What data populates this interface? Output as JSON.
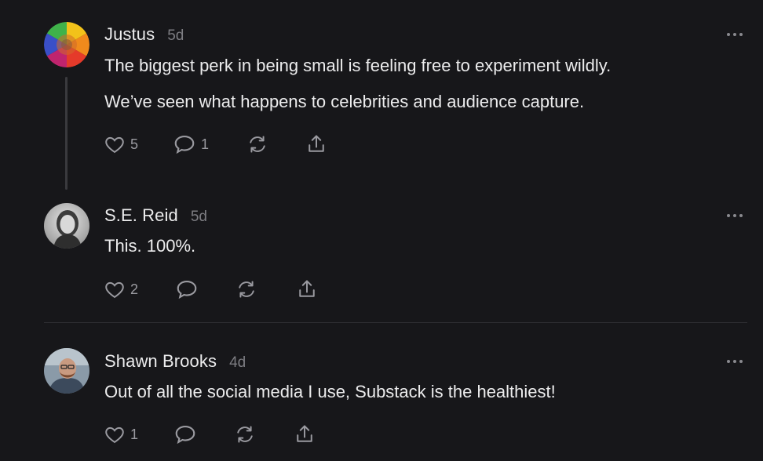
{
  "comments": [
    {
      "name": "Justus",
      "time": "5d",
      "paragraphs": [
        "The biggest perk in being small is feeling free to experiment wildly.",
        "We’ve seen what happens to celebrities and audience capture."
      ],
      "likes": "5",
      "replies": "1"
    },
    {
      "name": "S.E. Reid",
      "time": "5d",
      "paragraphs": [
        "This. 100%."
      ],
      "likes": "2",
      "replies": ""
    },
    {
      "name": "Shawn Brooks",
      "time": "4d",
      "paragraphs": [
        "Out of all the social media I use, Substack is the healthiest!"
      ],
      "likes": "1",
      "replies": ""
    }
  ],
  "icons": {
    "like": "heart-icon",
    "reply": "comment-icon",
    "restack": "restack-icon",
    "share": "share-icon",
    "more": "more-icon"
  },
  "colors": {
    "background": "#17171a",
    "text": "#ececed",
    "muted": "#7d7d82",
    "icon": "#9a9aa0"
  }
}
